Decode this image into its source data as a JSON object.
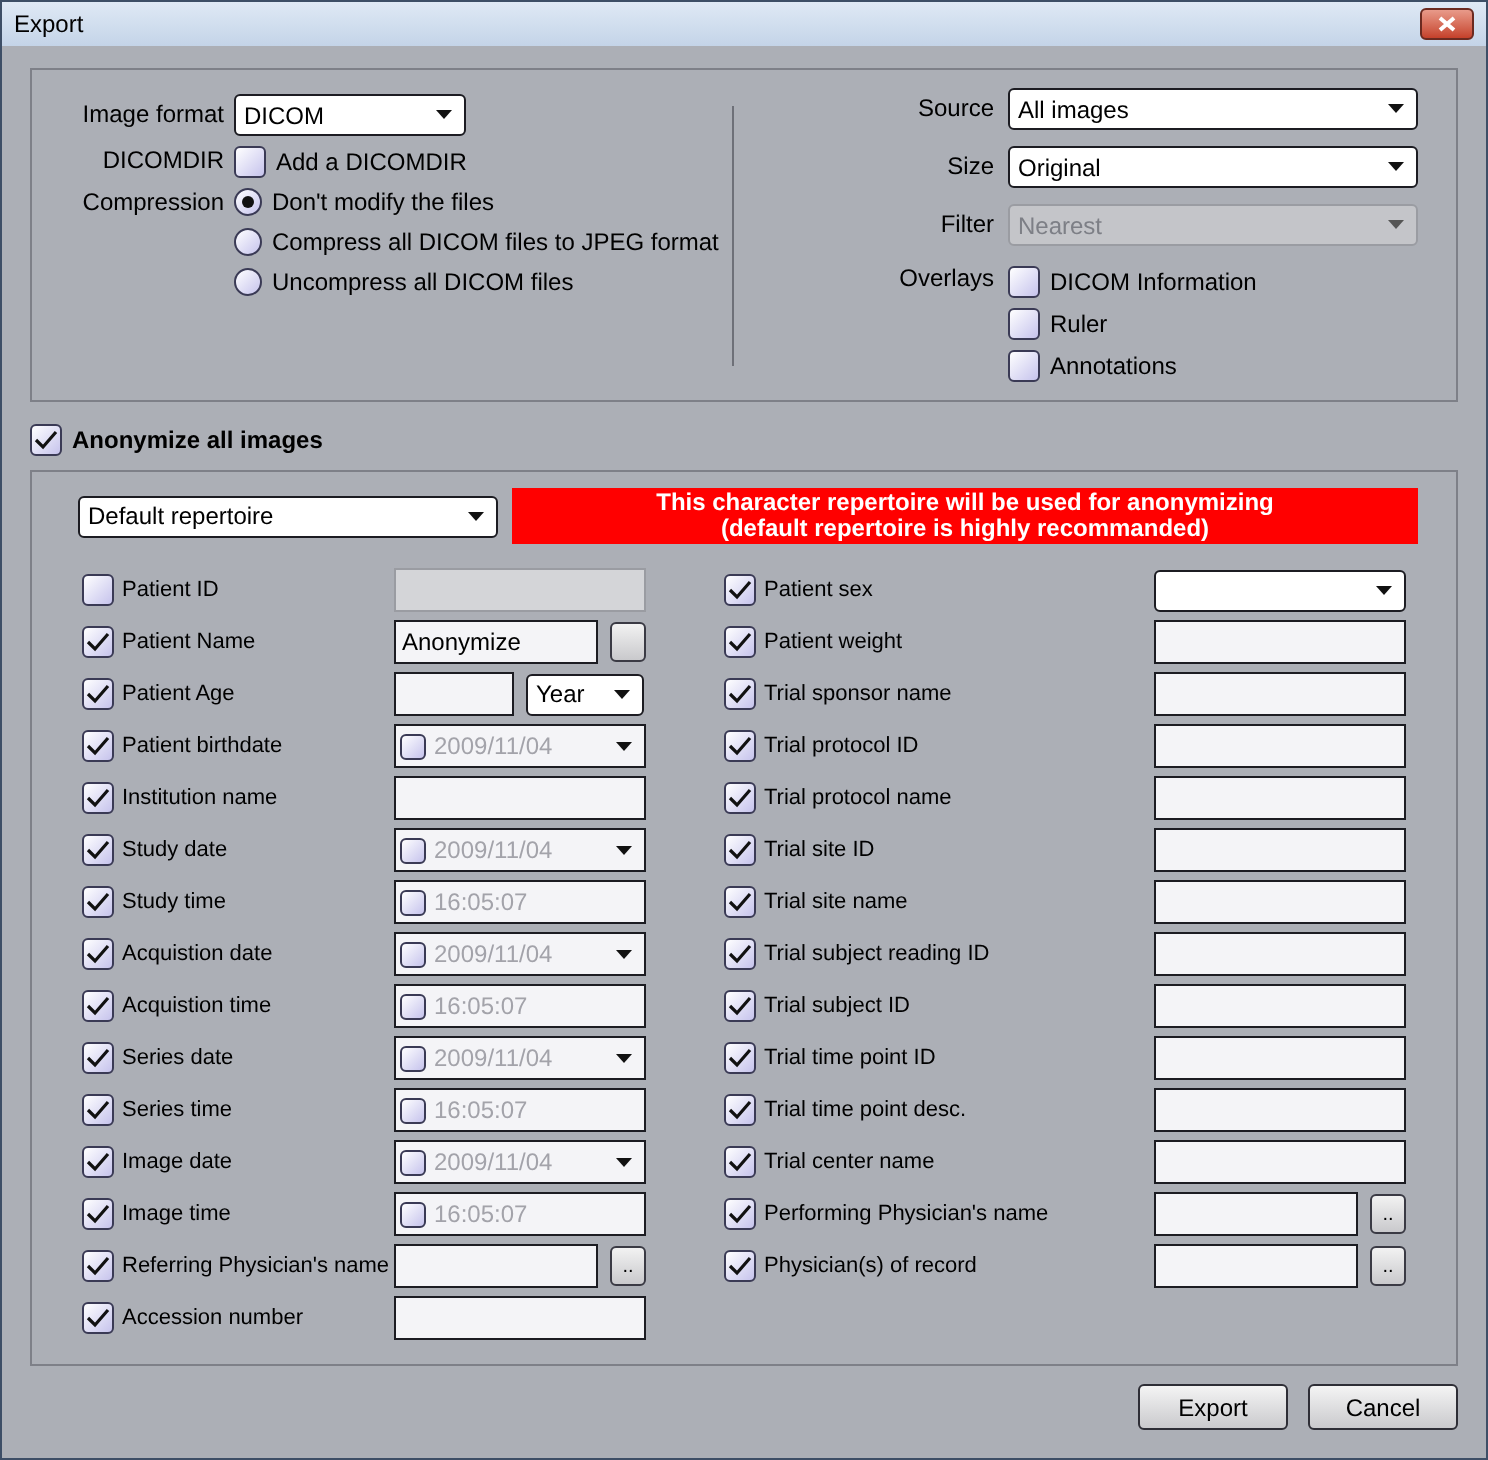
{
  "window": {
    "title": "Export"
  },
  "export_options": {
    "image_format": {
      "label": "Image format",
      "value": "DICOM"
    },
    "dicomdir": {
      "label": "DICOMDIR",
      "option": "Add a DICOMDIR",
      "checked": false
    },
    "compression": {
      "label": "Compression",
      "options": [
        {
          "label": "Don't modify the files",
          "selected": true
        },
        {
          "label": "Compress all DICOM files to JPEG format",
          "selected": false
        },
        {
          "label": "Uncompress all DICOM files",
          "selected": false
        }
      ]
    },
    "source": {
      "label": "Source",
      "value": "All images"
    },
    "size": {
      "label": "Size",
      "value": "Original"
    },
    "filter": {
      "label": "Filter",
      "value": "Nearest",
      "disabled": true
    },
    "overlays": {
      "label": "Overlays",
      "options": [
        {
          "label": "DICOM Information",
          "checked": false
        },
        {
          "label": "Ruler",
          "checked": false
        },
        {
          "label": "Annotations",
          "checked": false
        }
      ]
    }
  },
  "anonymize": {
    "label": "Anonymize all images",
    "checked": true,
    "repertoire": {
      "value": "Default repertoire"
    },
    "notice": "This character repertoire will be used for anonymizing\n(default repertoire is highly recommanded)",
    "left_fields": [
      {
        "label": "Patient ID",
        "checked": false,
        "kind": "disabled"
      },
      {
        "label": "Patient Name",
        "checked": true,
        "kind": "text_button",
        "value": "Anonymize"
      },
      {
        "label": "Patient Age",
        "checked": true,
        "kind": "number_unit",
        "unit": "Year"
      },
      {
        "label": "Patient birthdate",
        "checked": true,
        "kind": "date",
        "value": "2009/11/04",
        "value_checked": false
      },
      {
        "label": "Institution name",
        "checked": true,
        "kind": "text"
      },
      {
        "label": "Study date",
        "checked": true,
        "kind": "date",
        "value": "2009/11/04",
        "value_checked": false
      },
      {
        "label": "Study time",
        "checked": true,
        "kind": "time",
        "value": "16:05:07",
        "value_checked": false
      },
      {
        "label": "Acquistion date",
        "checked": true,
        "kind": "date",
        "value": "2009/11/04",
        "value_checked": false
      },
      {
        "label": "Acquistion time",
        "checked": true,
        "kind": "time",
        "value": "16:05:07",
        "value_checked": false
      },
      {
        "label": "Series date",
        "checked": true,
        "kind": "date",
        "value": "2009/11/04",
        "value_checked": false
      },
      {
        "label": "Series time",
        "checked": true,
        "kind": "time",
        "value": "16:05:07",
        "value_checked": false
      },
      {
        "label": "Image date",
        "checked": true,
        "kind": "date",
        "value": "2009/11/04",
        "value_checked": false
      },
      {
        "label": "Image time",
        "checked": true,
        "kind": "time",
        "value": "16:05:07",
        "value_checked": false
      },
      {
        "label": "Referring Physician's name",
        "checked": true,
        "kind": "text_button",
        "button": ".."
      },
      {
        "label": "Accession number",
        "checked": true,
        "kind": "text"
      }
    ],
    "right_fields": [
      {
        "label": "Patient sex",
        "checked": true,
        "kind": "dropdown"
      },
      {
        "label": "Patient weight",
        "checked": true,
        "kind": "text"
      },
      {
        "label": "Trial sponsor name",
        "checked": true,
        "kind": "text"
      },
      {
        "label": "Trial protocol ID",
        "checked": true,
        "kind": "text"
      },
      {
        "label": "Trial protocol name",
        "checked": true,
        "kind": "text"
      },
      {
        "label": "Trial site ID",
        "checked": true,
        "kind": "text"
      },
      {
        "label": "Trial site name",
        "checked": true,
        "kind": "text"
      },
      {
        "label": "Trial subject reading ID",
        "checked": true,
        "kind": "text"
      },
      {
        "label": "Trial subject ID",
        "checked": true,
        "kind": "text"
      },
      {
        "label": "Trial time point ID",
        "checked": true,
        "kind": "text"
      },
      {
        "label": "Trial time point desc.",
        "checked": true,
        "kind": "text"
      },
      {
        "label": "Trial center name",
        "checked": true,
        "kind": "text"
      },
      {
        "label": "Performing Physician's name",
        "checked": true,
        "kind": "text_button",
        "button": ".."
      },
      {
        "label": "Physician(s) of record",
        "checked": true,
        "kind": "text_button",
        "button": ".."
      }
    ]
  },
  "buttons": [
    {
      "label": "Export"
    },
    {
      "label": "Cancel"
    }
  ]
}
